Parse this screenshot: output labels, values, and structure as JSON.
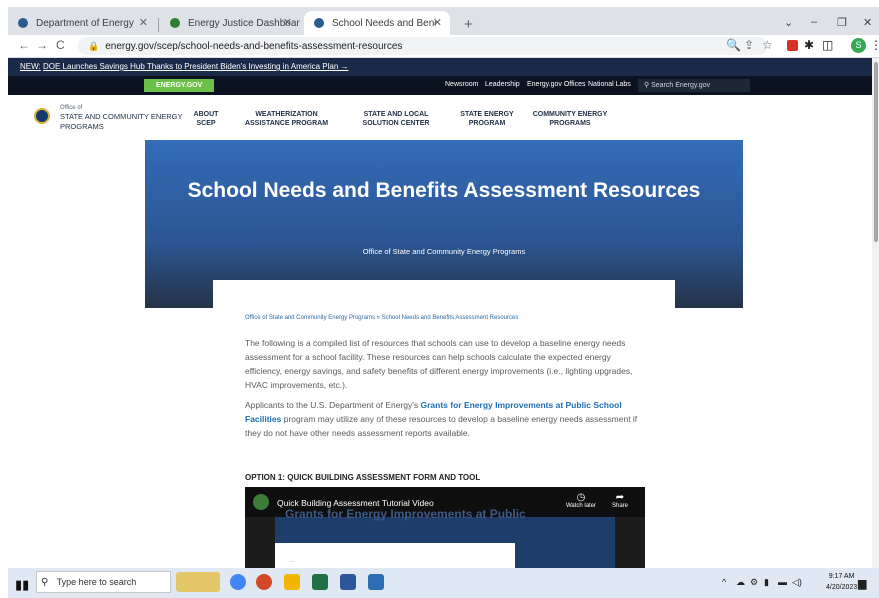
{
  "browser": {
    "tabs": [
      {
        "title": "Department of Energy",
        "active": false,
        "color": "#2a5d8f"
      },
      {
        "title": "Energy Justice Dashboard",
        "active": false,
        "color": "#2e7d32"
      },
      {
        "title": "School Needs and Benefits Asses...",
        "active": true,
        "color": "#2a5d8f"
      }
    ],
    "new_tab": "+",
    "window_controls": [
      "⌄",
      "–",
      "❐",
      "✕"
    ],
    "nav": {
      "back": "←",
      "forward": "→",
      "reload": "C"
    },
    "url": "energy.gov/scep/school-needs-and-benefits-assessment-resources",
    "profile_initial": "S"
  },
  "announcement": {
    "prefix": "NEW:",
    "text": "DOE Launches Savings Hub Thanks to President Biden's Investing in America Plan →"
  },
  "utility_bar": {
    "badge": "ENERGY.GOV",
    "links": [
      "Newsroom",
      "Leadership",
      "Energy.gov Offices",
      "National Labs"
    ],
    "search_placeholder": "Search Energy.gov"
  },
  "site_nav": {
    "office_prefix": "Office of",
    "office_name": "STATE AND COMMUNITY ENERGY PROGRAMS",
    "items": [
      "ABOUT SCEP",
      "WEATHERIZATION ASSISTANCE PROGRAM",
      "STATE AND LOCAL SOLUTION CENTER",
      "STATE ENERGY PROGRAM",
      "COMMUNITY ENERGY PROGRAMS"
    ]
  },
  "hero": {
    "title": "School Needs and Benefits Assessment Resources",
    "subtitle": "Office of State and Community Energy Programs"
  },
  "content": {
    "breadcrumb": "Office of State and Community Energy Programs » School Needs and Benefits Assessment Resources",
    "para1": "The following is a compiled list of resources that schools can use to develop a baseline energy needs assessment for a school facility. These resources can help schools calculate the expected energy efficiency, energy savings, and safety benefits of different energy improvements (i.e., lighting upgrades, HVAC improvements, etc.).",
    "para2_before": "Applicants to the U.S. Department of Energy's ",
    "para2_link": "Grants for Energy Improvements at Public School Facilities",
    "para2_after": " program may utilize any of these resources to develop a baseline energy needs assessment if they do not have other needs assessment reports available.",
    "option_heading": "OPTION 1: QUICK BUILDING ASSESSMENT FORM AND TOOL",
    "video": {
      "title": "Quick Building Assessment Tutorial Video",
      "watch_later": "Watch later",
      "share": "Share",
      "slide_title": "Grants for Energy Improvements at Public"
    }
  },
  "taskbar": {
    "search_placeholder": "Type here to search",
    "time": "9:17 AM",
    "date": "4/20/2023"
  }
}
